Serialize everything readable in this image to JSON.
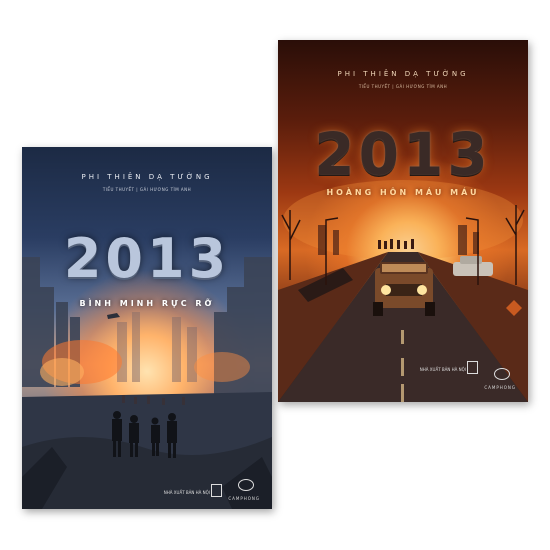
{
  "left_book": {
    "author": "PHI THIÊN DẠ TƯỜNG",
    "tagline": "TIỂU THUYẾT | GÁI HƯƠNG TÌM ANH",
    "title": "2013",
    "subtitle": "BÌNH MINH RỰC RỠ",
    "publisher": "NHÀ XUẤT BẢN HÀ NỘI",
    "brand": "CAMPHONG"
  },
  "right_book": {
    "author": "PHI THIÊN DẠ TƯỜNG",
    "tagline": "TIỂU THUYẾT | GÁI HƯƠNG TÌM ANH",
    "title": "2013",
    "subtitle": "HOÀNG HÔN MÁU MÁU",
    "publisher": "NHÀ XUẤT BẢN HÀ NỘI",
    "brand": "CAMPHONG"
  },
  "colors": {
    "left_title": "#b9c6dc",
    "right_title": "#3a2a26",
    "left_subtitle": "#ffffff",
    "right_subtitle": "#ffd9a0"
  }
}
